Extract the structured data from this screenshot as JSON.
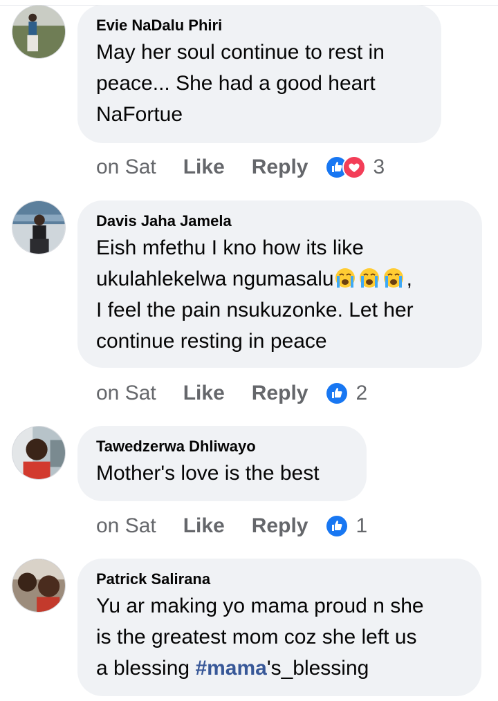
{
  "colors": {
    "bubble": "#f0f2f5",
    "meta": "#65676b",
    "hashtag": "#385898",
    "like": "#1877f2",
    "love": "#f33e58"
  },
  "comments": [
    {
      "author": "Evie NaDalu Phiri",
      "text_lines": [
        "May her soul continue to rest in",
        "peace... She had a good heart",
        "NaFortue"
      ],
      "time": "on Sat",
      "like_label": "Like",
      "reply_label": "Reply",
      "reactions": [
        "like-icon",
        "love-icon"
      ],
      "reaction_count": "3"
    },
    {
      "author": "Davis Jaha Jamela",
      "text_lines": [
        "Eish mfethu I kno how its like",
        "ukulahlekelwa ngumasalu",
        ",",
        "I feel the pain nsukuzonke. Let her",
        "continue resting in peace"
      ],
      "emojis": [
        "crying-face-emoji",
        "crying-face-emoji",
        "crying-face-emoji"
      ],
      "time": "on Sat",
      "like_label": "Like",
      "reply_label": "Reply",
      "reactions": [
        "like-icon"
      ],
      "reaction_count": "2"
    },
    {
      "author": "Tawedzerwa Dhliwayo",
      "text_lines": [
        "Mother's love is the best"
      ],
      "time": "on Sat",
      "like_label": "Like",
      "reply_label": "Reply",
      "reactions": [
        "like-icon"
      ],
      "reaction_count": "1"
    },
    {
      "author": "Patrick Salirana",
      "text_lines": [
        "Yu ar making yo mama proud n she",
        "is the greatest mom coz she left us",
        "a blessing ",
        "#mama",
        "'s_blessing"
      ],
      "time": "",
      "like_label": "",
      "reply_label": ""
    }
  ]
}
